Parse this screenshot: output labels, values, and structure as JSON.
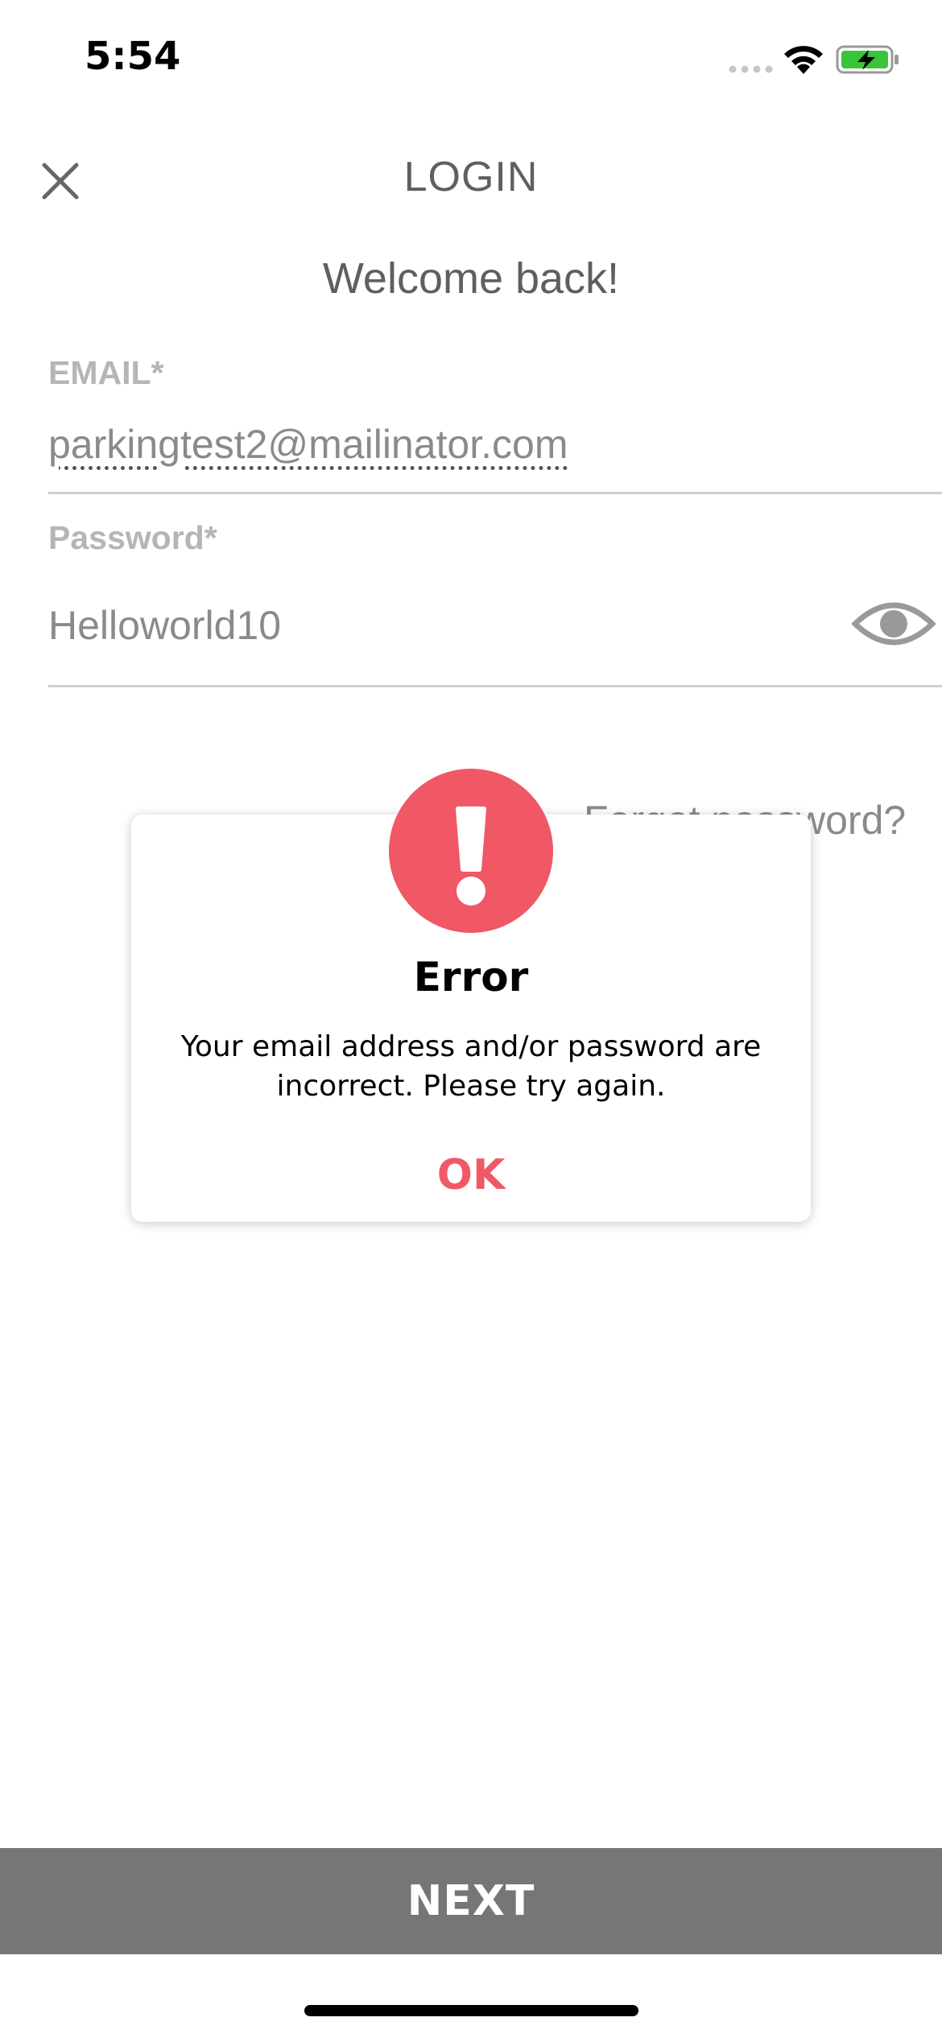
{
  "status_bar": {
    "time": "5:54",
    "icons": [
      "signal-icon",
      "wifi-icon",
      "battery-charging-icon"
    ]
  },
  "header": {
    "title": "LOGIN",
    "close_icon": "close-icon"
  },
  "welcome_text": "Welcome back!",
  "email": {
    "label": "EMAIL*",
    "value": "parkingtest2@mailinator.com"
  },
  "password": {
    "label": "Password*",
    "value": "Helloworld10",
    "toggle_icon": "eye-icon"
  },
  "forgot_password": "Forgot password?",
  "dialog": {
    "icon": "exclamation-icon",
    "title": "Error",
    "message": "Your email address and/or password are incorrect. Please try again.",
    "ok_label": "OK"
  },
  "next_label": "NEXT",
  "colors": {
    "accent": "#f05866",
    "next_button": "#767676",
    "text_gray": "#5f5f5f",
    "battery_green": "#3ac43b"
  }
}
